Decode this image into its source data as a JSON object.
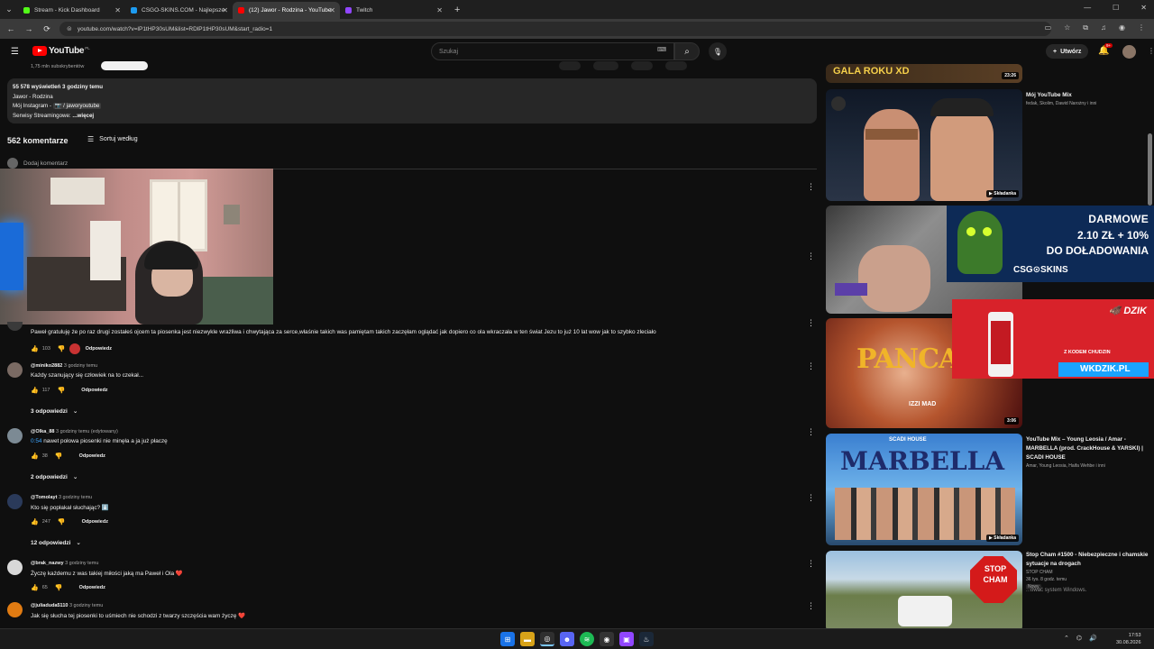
{
  "browser": {
    "tabs": [
      {
        "label": "Stream - Kick Dashboard",
        "color": "#53fc18",
        "active": false
      },
      {
        "label": "CSGO-SKINS.COM - Najlepsze",
        "color": "#1d9bf0",
        "active": false
      },
      {
        "label": "(12) Jawor - Rodzina - YouTube",
        "color": "#ff0000",
        "active": true
      },
      {
        "label": "Twitch",
        "color": "#9146ff",
        "active": false
      }
    ],
    "url": "youtube.com/watch?v=lP1tHP30sUM&list=RDlP1tHP30sUM&start_radio=1"
  },
  "youtube": {
    "logo_text": "YouTube",
    "logo_region": "PL",
    "search_placeholder": "Szukaj",
    "create_label": "Utwórz",
    "notif_count": "9+"
  },
  "video": {
    "subscribers": "1,75 mln subskrybentów"
  },
  "description": {
    "meta": "55 578 wyświetleń  3 godziny temu",
    "line1": "Jawor - Rodzina",
    "line2_prefix": "Mój Instagram - ",
    "line2_tag": "📷 / jaworyoutube",
    "line3": "Serwisy Streamingowe:",
    "more": "...więcej"
  },
  "comments_header": {
    "count": "562 komentarze",
    "sort_label": "Sortuj według",
    "add_placeholder": "Dodaj komentarz"
  },
  "comments": [
    {
      "author": "",
      "time": "",
      "text": "Paweł gratuluję że po raz drugi zostałeś ojcem ta piosenka jest niezwykle wrażliwa i chwytająca za serce,właśnie takich was pamiętam takich zaczęłam oglądać jak dopiero co ola wkraczała w ten świat Jezu to już 10 lat wow jak to szybko zleciało",
      "likes": "103",
      "reply": "Odpowiedz",
      "replies": ""
    },
    {
      "author": "@miniko2882",
      "time": "3 godziny temu",
      "text": "Każdy szanujący się człowiek na to czekał...",
      "likes": "117",
      "reply": "Odpowiedz",
      "replies": "3 odpowiedzi"
    },
    {
      "author": "@Olka_88",
      "time": "3 godziny temu (edytowany)",
      "timestamp": "0:54",
      "text": " nawet połowa piosenki nie minęła a ja już płaczę",
      "likes": "38",
      "reply": "Odpowiedz",
      "replies": "2 odpowiedzi"
    },
    {
      "author": "@Tomolayt",
      "time": "3 godziny temu",
      "text": "Kto się popłakał słuchając? ⬇️",
      "likes": "247",
      "reply": "Odpowiedz",
      "replies": "12 odpowiedzi"
    },
    {
      "author": "@brak_nazwy",
      "time": "3 godziny temu",
      "text": "Życzę każdemu z was takiej miłości jaką ma Paweł i Ola ❤️",
      "likes": "65",
      "reply": "Odpowiedz",
      "replies": ""
    },
    {
      "author": "@juliaduda5110",
      "time": "3 godziny temu",
      "text": "Jak się słucha tej piosenki to uśmiech nie schodzi z twarzy szczęścia wam życzę ❤️",
      "likes": "",
      "reply": "",
      "replies": ""
    }
  ],
  "sidebar": {
    "items": [
      {
        "title": "",
        "channel": "",
        "meta": "",
        "duration": "23:26",
        "thumb_text": "GALA ROKU XD"
      },
      {
        "title": "Mój YouTube Mix",
        "channel": "fedak, Skolim, Dawid Narożny i inni",
        "meta": "",
        "duration": "Składanka"
      },
      {
        "title": "",
        "channel": "",
        "meta": "",
        "duration": "",
        "thumb_text": ""
      },
      {
        "title": "",
        "channel": "",
        "meta": "",
        "duration": "3:06",
        "thumb_text": "PANCAKE",
        "thumb_sub": "IZZI MAD"
      },
      {
        "title": "YouTube Mix – Young Leosia / Amar - MARBELLA (prod. CrackHouse & YARSKI) | SCADI HOUSE",
        "channel": "Amar, Young Leosia, Haifa Wehbe i inni",
        "meta": "",
        "duration": "Składanka",
        "thumb_text": "MARBELLA",
        "thumb_top": "SCADI HOUSE"
      },
      {
        "title": "Stop Cham #1500 - Niebezpieczne i chamskie sytuacje na drogach",
        "channel": "STOP CHAM",
        "meta": "36 tys.  8 godz. temu",
        "badge": "Nowy",
        "duration": "",
        "thumb_text": "STOP CHAM"
      }
    ]
  },
  "ads": {
    "csgo": {
      "line1": "DARMOWE",
      "line2": "2.10 ZŁ + 10%",
      "line3": "DO DOŁADOWANIA",
      "brand": "CSG⊙SKINS"
    },
    "dzik": {
      "logo": "DZIK",
      "slogan": "Z KODEM CHUDZIN",
      "www": "WKDZIK.PL"
    }
  },
  "windows": {
    "watermark": "...ować system Windows.",
    "time": "17:53",
    "date": "30.08.2026"
  }
}
